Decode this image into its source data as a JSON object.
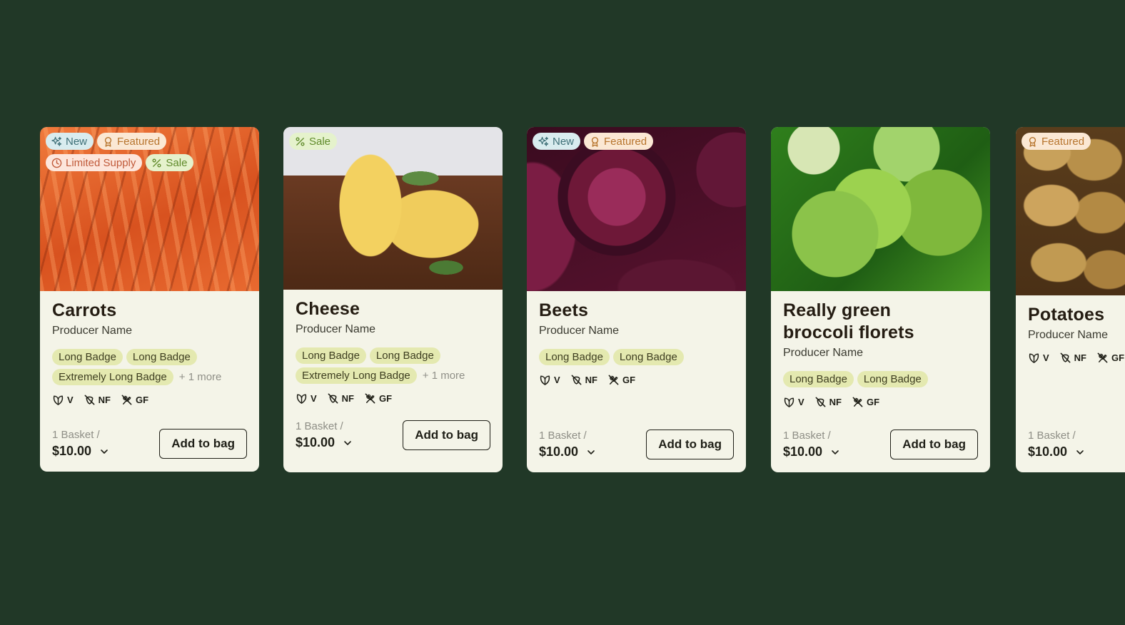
{
  "cards": [
    {
      "title": "Carrots",
      "producer": "Producer Name",
      "badges": {
        "new": "New",
        "featured": "Featured",
        "limited": "Limited Supply",
        "sale": "Sale"
      },
      "tags": [
        "Long Badge",
        "Long Badge",
        "Extremely Long Badge"
      ],
      "more": "+ 1 more",
      "diet": [
        "V",
        "NF",
        "GF"
      ],
      "unit": "1 Basket /",
      "price": "$10.00",
      "button": "Add to bag"
    },
    {
      "title": "Cheese",
      "producer": "Producer Name",
      "badges": {
        "sale": "Sale"
      },
      "tags": [
        "Long Badge",
        "Long Badge",
        "Extremely Long Badge"
      ],
      "more": "+ 1 more",
      "diet": [
        "V",
        "NF",
        "GF"
      ],
      "unit": "1 Basket /",
      "price": "$10.00",
      "button": "Add to bag"
    },
    {
      "title": "Beets",
      "producer": "Producer Name",
      "badges": {
        "new": "New",
        "featured": "Featured"
      },
      "tags": [
        "Long Badge",
        "Long Badge"
      ],
      "diet": [
        "V",
        "NF",
        "GF"
      ],
      "unit": "1 Basket /",
      "price": "$10.00",
      "button": "Add to bag"
    },
    {
      "title": "Really green broccoli florets",
      "producer": "Producer Name",
      "badges": {},
      "tags": [
        "Long Badge",
        "Long Badge"
      ],
      "diet": [
        "V",
        "NF",
        "GF"
      ],
      "unit": "1 Basket /",
      "price": "$10.00",
      "button": "Add to bag"
    },
    {
      "title": "Potatoes",
      "producer": "Producer Name",
      "badges": {
        "featured": "Featured"
      },
      "diet": [
        "V",
        "NF",
        "GF"
      ],
      "unit": "1 Basket /",
      "price": "$10.00"
    }
  ]
}
